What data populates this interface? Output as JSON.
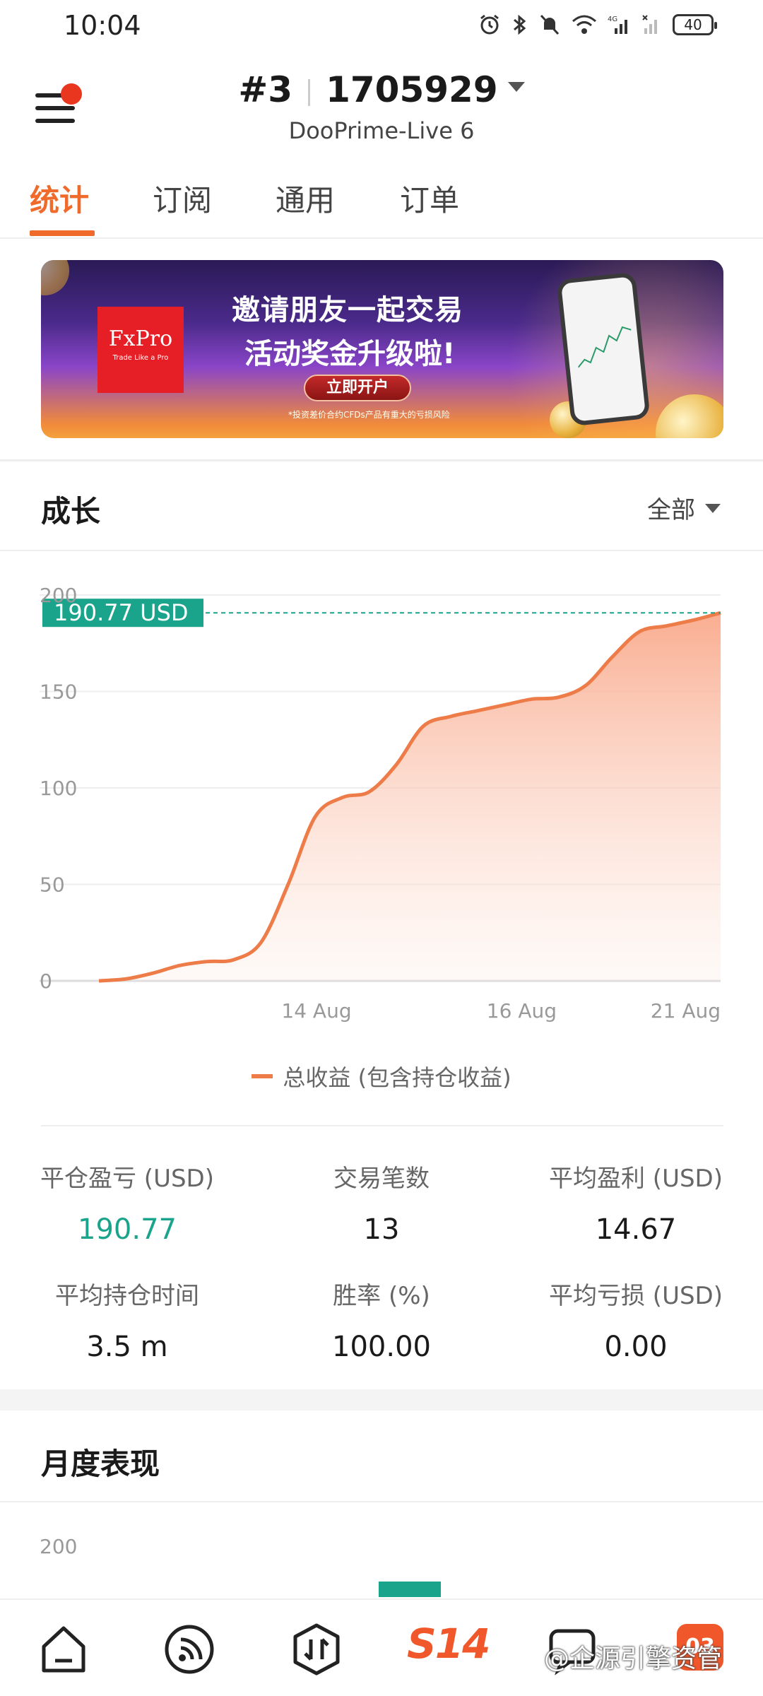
{
  "status_bar": {
    "time": "10:04",
    "battery": "40",
    "network": "4G"
  },
  "header": {
    "account_number": "#3",
    "account_id": "1705929",
    "server": "DooPrime-Live 6"
  },
  "tabs": [
    {
      "label": "统计",
      "active": true
    },
    {
      "label": "订阅",
      "active": false
    },
    {
      "label": "通用",
      "active": false
    },
    {
      "label": "订单",
      "active": false
    }
  ],
  "banner": {
    "brand": "FxPro",
    "brand_tagline": "Trade Like a Pro",
    "headline": "邀请朋友一起交易",
    "subheadline": "活动奖金升级啦!",
    "cta": "立即开户",
    "disclaimer": "*投资差价合约CFDs产品有重大的亏损风险"
  },
  "growth": {
    "title": "成长",
    "range": "全部",
    "current_value_label": "190.77 USD"
  },
  "chart_data": {
    "type": "area",
    "title": "",
    "xlabel": "",
    "ylabel": "",
    "ylim": [
      0,
      200
    ],
    "y_ticks": [
      0,
      50,
      100,
      150,
      200
    ],
    "x_tick_labels": [
      "14 Aug",
      "16 Aug",
      "21 Aug"
    ],
    "series": [
      {
        "name": "总收益 (包含持仓收益)",
        "color": "#ee7c48",
        "values": [
          0,
          1,
          4,
          8,
          10,
          11,
          20,
          50,
          85,
          95,
          98,
          112,
          132,
          137,
          140,
          143,
          146,
          147,
          153,
          168,
          181,
          184,
          187,
          190.77
        ]
      }
    ],
    "reference_line": 190.77,
    "grid": true,
    "legend": "bottom"
  },
  "legend": {
    "label": "总收益 (包含持仓收益)"
  },
  "stats": [
    {
      "label": "平仓盈亏 (USD)",
      "value": "190.77",
      "highlight": true
    },
    {
      "label": "交易笔数",
      "value": "13",
      "highlight": false
    },
    {
      "label": "平均盈利 (USD)",
      "value": "14.67",
      "highlight": false
    },
    {
      "label": "平均持仓时间",
      "value": "3.5 m",
      "highlight": false
    },
    {
      "label": "胜率 (%)",
      "value": "100.00",
      "highlight": false
    },
    {
      "label": "平均亏损 (USD)",
      "value": "0.00",
      "highlight": false
    }
  ],
  "monthly": {
    "title": "月度表现",
    "first_tick": "200"
  },
  "bottom_nav": {
    "center_label": "S14",
    "badge": "03"
  },
  "watermark": "@企源引擎资管",
  "colors": {
    "accent": "#f06b2b",
    "positive": "#1aa48c",
    "series": "#ee7c48"
  }
}
